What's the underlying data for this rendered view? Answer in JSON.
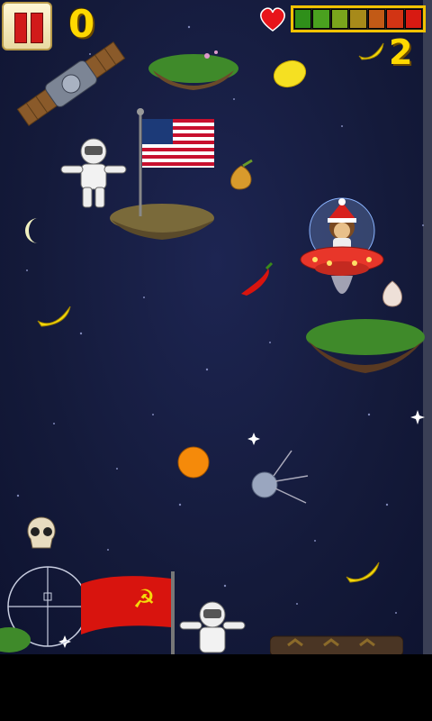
{
  "hud": {
    "score": "0",
    "banana_count": "2",
    "health_colors": [
      "#2f8f1a",
      "#4aa11f",
      "#7aa51c",
      "#a78a1a",
      "#c25a16",
      "#d23414",
      "#d81a12"
    ]
  },
  "colors": {
    "space": "#151b3d",
    "score_yellow": "#ffd800",
    "health_frame": "#f2c200"
  }
}
